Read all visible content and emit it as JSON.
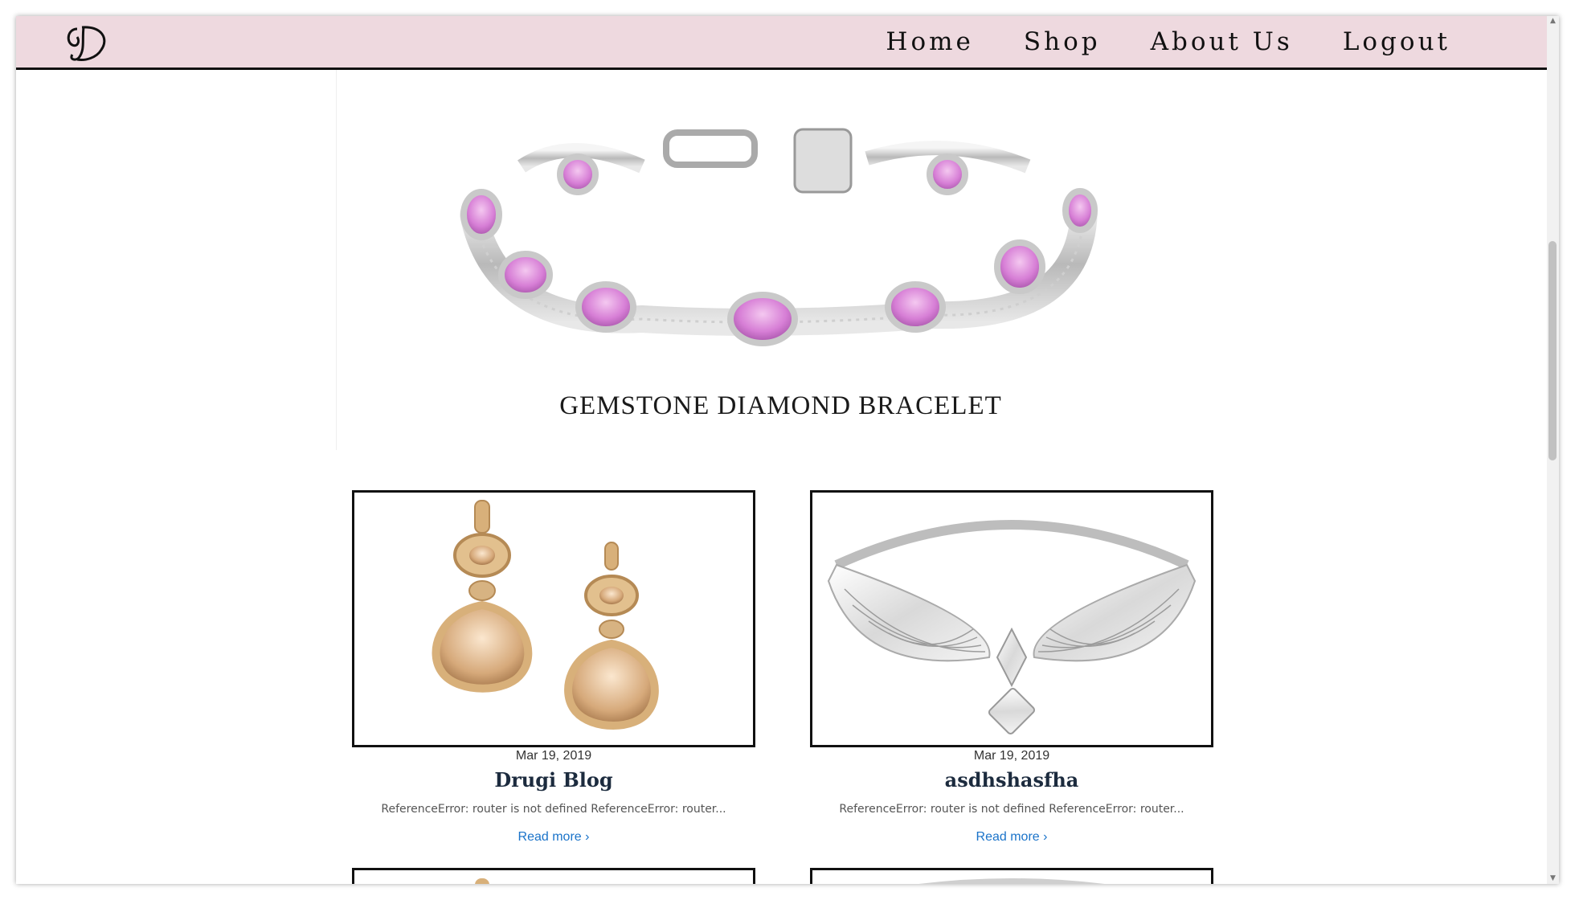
{
  "nav": {
    "logo_alt": "D",
    "links": [
      "Home",
      "Shop",
      "About Us",
      "Logout"
    ]
  },
  "featured": {
    "title": "GEMSTONE DIAMOND BRACELET"
  },
  "posts": [
    {
      "date": "Mar 19, 2019",
      "title": "Drugi Blog",
      "excerpt": "ReferenceError: router is not defined ReferenceError: router...",
      "read_more": "Read more ›"
    },
    {
      "date": "Mar 19, 2019",
      "title": "asdhshasfha",
      "excerpt": "ReferenceError: router is not defined ReferenceError: router...",
      "read_more": "Read more ›"
    }
  ],
  "colors": {
    "nav_background": "#eed9df",
    "link_blue": "#1a73c9",
    "title_navy": "#1c2b3e"
  }
}
